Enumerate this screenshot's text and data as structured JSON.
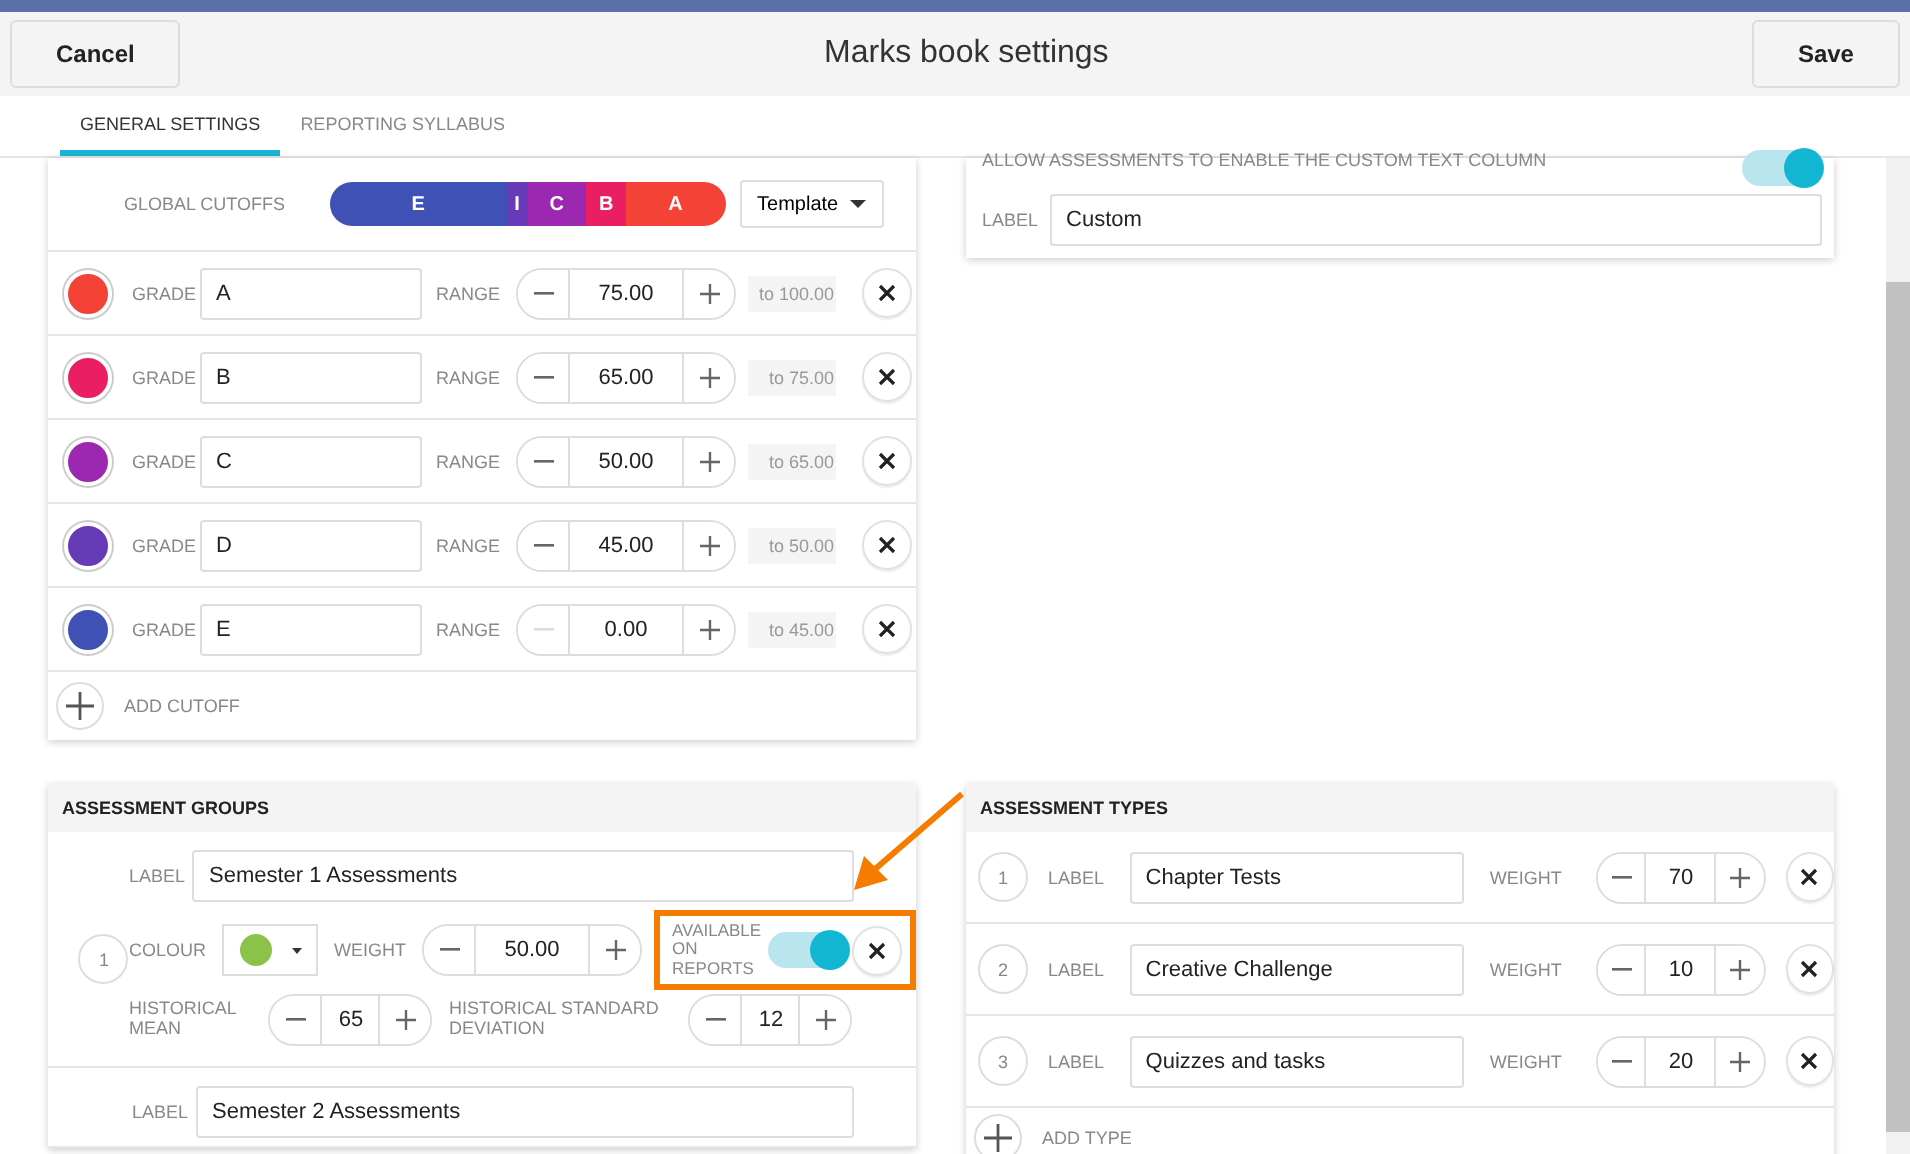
{
  "header": {
    "cancel": "Cancel",
    "title": "Marks book settings",
    "save": "Save"
  },
  "tabs": [
    {
      "label": "GENERAL SETTINGS",
      "selected": true
    },
    {
      "label": "REPORTING SYLLABUS",
      "selected": false
    }
  ],
  "cutoffs": {
    "label": "GLOBAL CUTOFFS",
    "segments": [
      {
        "label": "E"
      },
      {
        "label": "I"
      },
      {
        "label": "C"
      },
      {
        "label": "B"
      },
      {
        "label": "A"
      }
    ],
    "template": "Template",
    "add": "ADD CUTOFF",
    "grades": [
      {
        "color": "#f44336",
        "grade_label": "GRADE",
        "grade": "A",
        "range_label": "RANGE",
        "value": "75.00",
        "to": "to 100.00",
        "minus_disabled": false
      },
      {
        "color": "#e91e63",
        "grade_label": "GRADE",
        "grade": "B",
        "range_label": "RANGE",
        "value": "65.00",
        "to": "to 75.00",
        "minus_disabled": false
      },
      {
        "color": "#9c27b0",
        "grade_label": "GRADE",
        "grade": "C",
        "range_label": "RANGE",
        "value": "50.00",
        "to": "to 65.00",
        "minus_disabled": false
      },
      {
        "color": "#673ab7",
        "grade_label": "GRADE",
        "grade": "D",
        "range_label": "RANGE",
        "value": "45.00",
        "to": "to 50.00",
        "minus_disabled": false
      },
      {
        "color": "#3f51b5",
        "grade_label": "GRADE",
        "grade": "E",
        "range_label": "RANGE",
        "value": "0.00",
        "to": "to 45.00",
        "minus_disabled": true
      }
    ]
  },
  "custom": {
    "text": "ALLOW ASSESSMENTS TO ENABLE THE CUSTOM TEXT COLUMN",
    "on": true,
    "label_caption": "LABEL",
    "label": "Custom"
  },
  "groups": {
    "title": "ASSESSMENT GROUPS",
    "items": [
      {
        "number": "1",
        "label_caption": "LABEL",
        "label": "Semester 1 Assessments",
        "colour_caption": "COLOUR",
        "color": "#8bc34a",
        "weight_caption": "WEIGHT",
        "weight": "50.00",
        "available_caption": "AVAILABLE ON REPORTS",
        "available": true,
        "highlighted": true,
        "mean_caption": "HISTORICAL MEAN",
        "mean": "65",
        "sd_caption": "HISTORICAL STANDARD DEVIATION",
        "sd": "12"
      },
      {
        "label_caption": "LABEL",
        "label": "Semester 2 Assessments"
      }
    ]
  },
  "types": {
    "title": "ASSESSMENT TYPES",
    "add": "ADD TYPE",
    "items": [
      {
        "number": "1",
        "label_caption": "LABEL",
        "label": "Chapter Tests",
        "weight_caption": "WEIGHT",
        "weight": "70"
      },
      {
        "number": "2",
        "label_caption": "LABEL",
        "label": "Creative Challenge",
        "weight_caption": "WEIGHT",
        "weight": "10"
      },
      {
        "number": "3",
        "label_caption": "LABEL",
        "label": "Quizzes and tasks",
        "weight_caption": "WEIGHT",
        "weight": "20"
      }
    ]
  }
}
